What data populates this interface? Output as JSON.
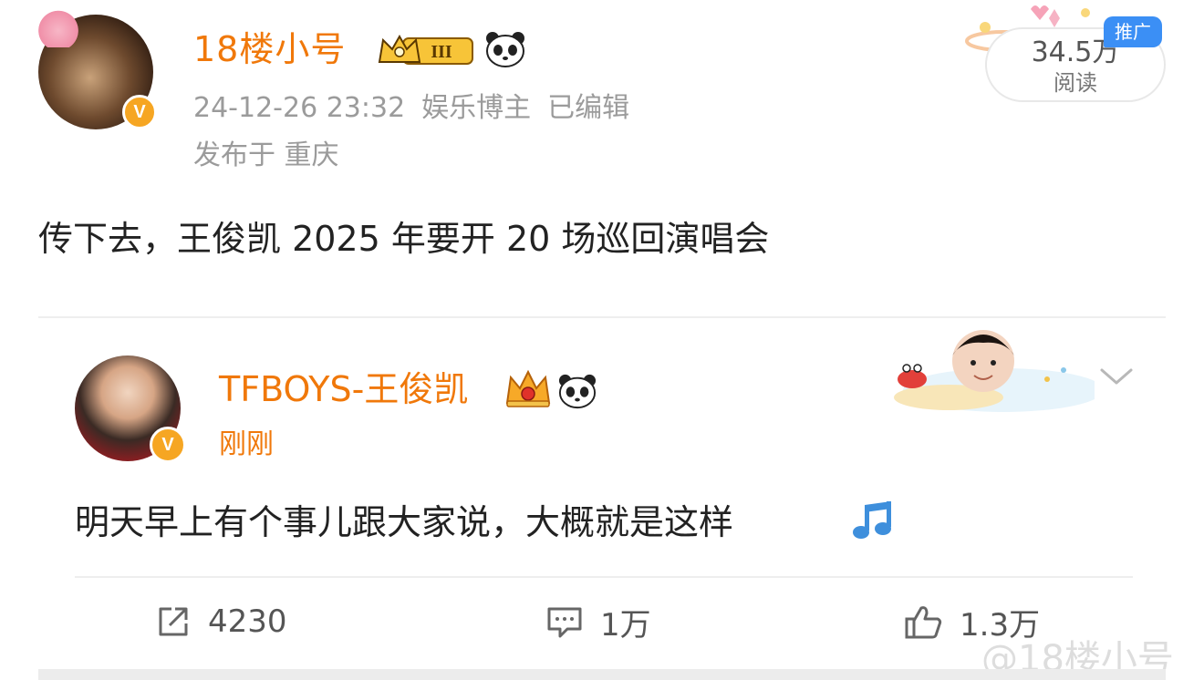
{
  "post": {
    "username": "18楼小号",
    "date_time": "24-12-26 23:32",
    "role": "娱乐博主",
    "edited": "已编辑",
    "location": "发布于 重庆",
    "text": "传下去，王俊凯 2025 年要开 20 场巡回演唱会",
    "read_count": "34.5万",
    "read_label": "阅读",
    "promo_tag": "推广",
    "level_badge": "III",
    "avatar_badge": "V"
  },
  "repost": {
    "username": "TFBOYS-王俊凯",
    "time": "刚刚",
    "text": "明天早上有个事儿跟大家说，大概就是这样",
    "avatar_badge": "V",
    "menu_icon": "chevron-down-icon",
    "emoji": "music-note-icon"
  },
  "actions": {
    "repost_count": "4230",
    "comment_count": "1万",
    "like_count": "1.3万"
  },
  "watermark": "@18楼小号",
  "colors": {
    "username": "#f0780a",
    "meta_gray": "#9b9b9b",
    "promo_blue": "#3b8ff5",
    "verified_badge": "#f6a623"
  }
}
